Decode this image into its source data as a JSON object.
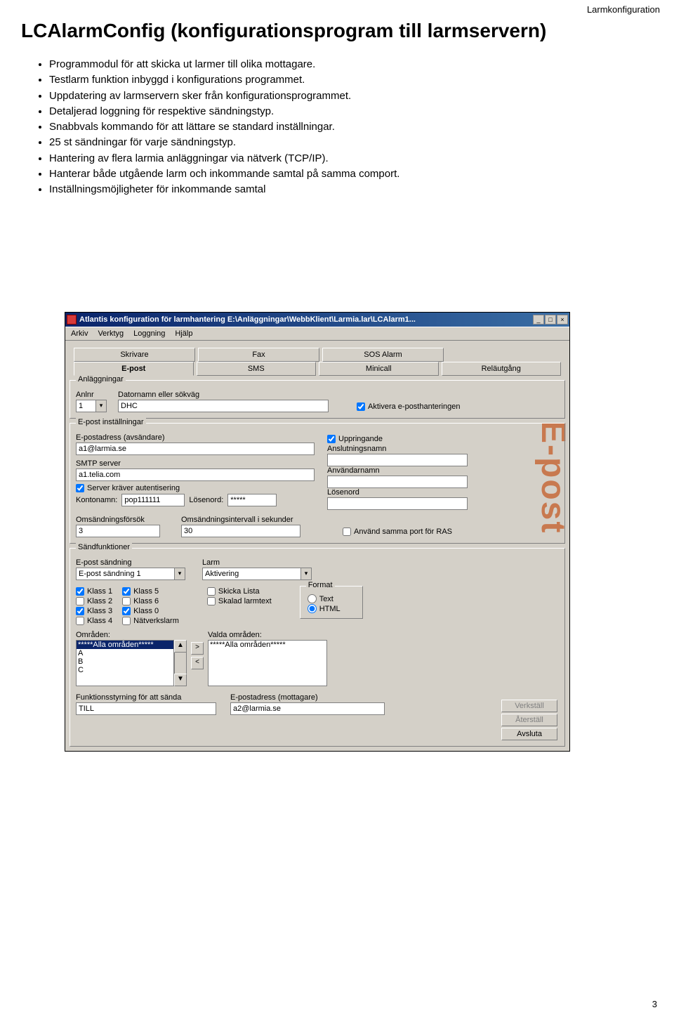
{
  "doc": {
    "header_right": "Larmkonfiguration",
    "title": "LCAlarmConfig (konfigurationsprogram till larmservern)",
    "bullets": [
      "Programmodul för att skicka ut larmer till olika mottagare.",
      "Testlarm funktion inbyggd i konfigurations programmet.",
      "Uppdatering av larmservern sker från konfigurationsprogrammet.",
      "Detaljerad loggning för respektive sändningstyp.",
      "Snabbvals kommando för att lättare se standard inställningar.",
      "25 st sändningar för varje sändningstyp.",
      "Hantering av flera larmia anläggningar via nätverk (TCP/IP).",
      "Hanterar både utgående larm och inkommande samtal på samma comport.",
      "Inställningsmöjligheter för inkommande samtal"
    ],
    "page_number": "3"
  },
  "win": {
    "title": "Atlantis konfiguration för larmhantering E:\\Anläggningar\\WebbKlient\\Larmia.lar\\LCAlarm1...",
    "menu": {
      "m1": "Arkiv",
      "m2": "Verktyg",
      "m3": "Loggning",
      "m4": "Hjälp"
    },
    "tabs_row1": {
      "t1": "Skrivare",
      "t2": "Fax",
      "t3": "SOS Alarm"
    },
    "tabs_row2": {
      "t1": "E-post",
      "t2": "SMS",
      "t3": "Minicall",
      "t4": "Reläutgång"
    },
    "stamp": "E-post",
    "anl": {
      "legend": "Anläggningar",
      "anlnr_label": "Anlnr",
      "anlnr_value": "1",
      "path_label": "Datornamn eller sökväg",
      "path_value": "DHC",
      "activate_label": "Aktivera e-posthanteringen"
    },
    "epost": {
      "legend": "E-post inställningar",
      "sender_label": "E-postadress (avsändare)",
      "sender_value": "a1@larmia.se",
      "smtp_label": "SMTP server",
      "smtp_value": "a1.telia.com",
      "auth_label": "Server kräver autentisering",
      "konto_label": "Kontonamn:",
      "konto_value": "pop111111",
      "pw_label": "Lösenord:",
      "pw_value": "*****",
      "uppr_label": "Uppringande",
      "ansl_label": "Anslutningsnamn",
      "anv_label": "Användarnamn",
      "los_label": "Lösenord",
      "retry_label": "Omsändningsförsök",
      "retry_value": "3",
      "interval_label": "Omsändningsintervall i sekunder",
      "interval_value": "30",
      "ras_label": "Använd samma port för RAS"
    },
    "send": {
      "legend": "Sändfunktioner",
      "send_label": "E-post sändning",
      "send_value": "E-post sändning 1",
      "larm_label": "Larm",
      "larm_value": "Aktivering",
      "k1": "Klass 1",
      "k2": "Klass 2",
      "k3": "Klass 3",
      "k4": "Klass 4",
      "k5": "Klass 5",
      "k6": "Klass 6",
      "k0": "Klass 0",
      "nl": "Nätverkslarm",
      "skicka_lista": "Skicka Lista",
      "skalad": "Skalad larmtext",
      "format_legend": "Format",
      "fmt_text": "Text",
      "fmt_html": "HTML",
      "omr_label": "Områden:",
      "omr_all": "*****Alla områden*****",
      "omr_a": "A",
      "omr_b": "B",
      "omr_c": "C",
      "valda_label": "Valda områden:",
      "valda_all": "*****Alla områden*****",
      "funk_label": "Funktionsstyrning för att sända",
      "funk_value": "TILL",
      "mott_label": "E-postadress (mottagare)",
      "mott_value": "a2@larmia.se"
    },
    "buttons": {
      "verk": "Verkställ",
      "ater": "Återställ",
      "avsl": "Avsluta"
    }
  }
}
